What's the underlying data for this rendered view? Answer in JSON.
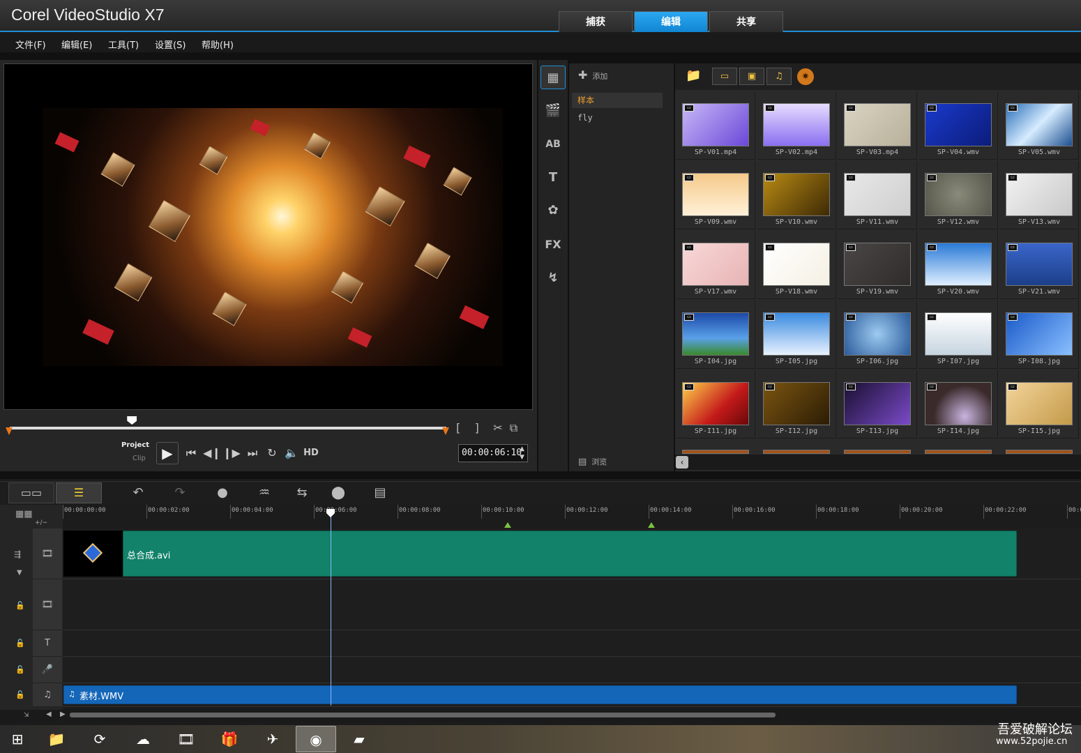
{
  "app": {
    "title": "Corel VideoStudio X7"
  },
  "mode_tabs": [
    {
      "label": "捕获"
    },
    {
      "label": "编辑"
    },
    {
      "label": "共享"
    }
  ],
  "menu": [
    {
      "label": "文件(F)"
    },
    {
      "label": "编辑(E)"
    },
    {
      "label": "工具(T)"
    },
    {
      "label": "设置(S)"
    },
    {
      "label": "帮助(H)"
    }
  ],
  "player": {
    "mode_project": "Project",
    "mode_clip": "Clip",
    "hd_label": "HD",
    "timecode": "00:00:06:10",
    "scrub_position": 0.28
  },
  "library": {
    "add_label": "添加",
    "browse_label": "浏览",
    "folders": [
      {
        "label": "样本"
      },
      {
        "label": "fly"
      }
    ],
    "items": [
      {
        "label": "SP-V01.mp4",
        "bg": "linear-gradient(135deg,#c7b8f7,#6b48d8)"
      },
      {
        "label": "SP-V02.mp4",
        "bg": "linear-gradient(180deg,#e7dcff,#8a6ff0)"
      },
      {
        "label": "SP-V03.mp4",
        "bg": "linear-gradient(135deg,#d9d4c2,#b8b09a)"
      },
      {
        "label": "SP-V04.wmv",
        "bg": "linear-gradient(135deg,#1a3acb,#0b1c7a)"
      },
      {
        "label": "SP-V05.wmv",
        "bg": "linear-gradient(135deg,#2a6fb8,#d6ecff 50%,#1c4f90)"
      },
      {
        "label": "SP-V09.wmv",
        "bg": "linear-gradient(180deg,#f5c98a,#fff1d8)"
      },
      {
        "label": "SP-V10.wmv",
        "bg": "linear-gradient(135deg,#b88a14,#3e2a05)"
      },
      {
        "label": "SP-V11.wmv",
        "bg": "linear-gradient(135deg,#e8e8e8,#cfcfcf)"
      },
      {
        "label": "SP-V12.wmv",
        "bg": "radial-gradient(circle,#8a8a7a,#55554a)"
      },
      {
        "label": "SP-V13.wmv",
        "bg": "linear-gradient(135deg,#f2f2f2,#c9c9c9)"
      },
      {
        "label": "SP-V17.wmv",
        "bg": "linear-gradient(135deg,#f8d8d8,#e8b4b4)"
      },
      {
        "label": "SP-V18.wmv",
        "bg": "linear-gradient(135deg,#ffffff,#f5f0e4)"
      },
      {
        "label": "SP-V19.wmv",
        "bg": "linear-gradient(135deg,#4a4646,#302c2c)"
      },
      {
        "label": "SP-V20.wmv",
        "bg": "linear-gradient(180deg,#2a7ad6,#dfefff)"
      },
      {
        "label": "SP-V21.wmv",
        "bg": "linear-gradient(180deg,#3a66c9,#1c3f8a)"
      },
      {
        "label": "SP-I04.jpg",
        "bg": "linear-gradient(180deg,#1c4aa8,#5aa0e8 60%,#3a8a2a)"
      },
      {
        "label": "SP-I05.jpg",
        "bg": "linear-gradient(180deg,#3a8ae0,#e8f2ff)"
      },
      {
        "label": "SP-I06.jpg",
        "bg": "radial-gradient(circle,#9ccaf0,#2a5a9a)"
      },
      {
        "label": "SP-I07.jpg",
        "bg": "linear-gradient(180deg,#ffffff,#c6d4e0)"
      },
      {
        "label": "SP-I08.jpg",
        "bg": "linear-gradient(135deg,#1a5ac9,#8ac0ff)"
      },
      {
        "label": "SP-I11.jpg",
        "bg": "linear-gradient(135deg,#ffd24a,#c41a1a 60%,#6a0808)"
      },
      {
        "label": "SP-I12.jpg",
        "bg": "linear-gradient(135deg,#7a5410,#2c1d05)"
      },
      {
        "label": "SP-I13.jpg",
        "bg": "linear-gradient(135deg,#1a1030,#7a4ac9)"
      },
      {
        "label": "SP-I14.jpg",
        "bg": "radial-gradient(circle at 60% 80%,#c8b4e0,#3a2a2a 60%)"
      },
      {
        "label": "SP-I15.jpg",
        "bg": "linear-gradient(135deg,#f2d49a,#c49a4a)"
      }
    ]
  },
  "timeline": {
    "ticks": [
      "00:00:00:00",
      "00:00:02:00",
      "00:00:04:00",
      "00:00:06:00",
      "00:00:08:00",
      "00:00:10:00",
      "00:00:12:00",
      "00:00:14:00",
      "00:00:16:00",
      "00:00:18:00",
      "00:00:20:00",
      "00:00:22:00",
      "00:0"
    ],
    "zoom_label": "+∕−",
    "video_clip": "总合成.avi",
    "music_clip": "素材.WMV"
  },
  "taskbar": {
    "watermark_cn": "吾爱破解论坛",
    "watermark_url": "www.52pojie.cn"
  }
}
